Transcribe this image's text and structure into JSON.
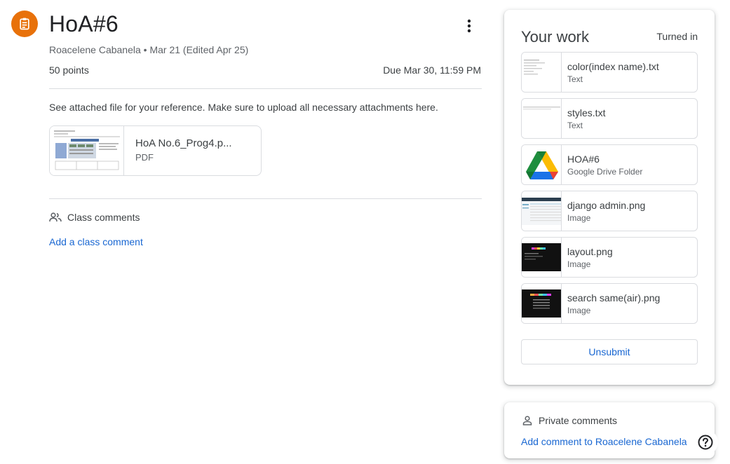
{
  "assignment": {
    "icon": "assignment-icon",
    "title": "HoA#6",
    "meta": "Roacelene Cabanela • Mar 21 (Edited Apr 25)",
    "points": "50 points",
    "due": "Due Mar 30, 11:59 PM",
    "instructions": "See attached file for your reference. Make sure to upload all necessary attachments here.",
    "attachment": {
      "name": "HoA No.6_Prog4.p...",
      "type": "PDF"
    },
    "accent_color": "#e8710a"
  },
  "class_comments": {
    "icon": "people-icon",
    "label": "Class comments",
    "add_label": "Add a class comment"
  },
  "your_work": {
    "title": "Your work",
    "status": "Turned in",
    "files": [
      {
        "name": "color(index name).txt",
        "type": "Text",
        "thumb": "text-doc"
      },
      {
        "name": "styles.txt",
        "type": "Text",
        "thumb": "text-doc"
      },
      {
        "name": "HOA#6",
        "type": "Google Drive Folder",
        "thumb": "drive-icon"
      },
      {
        "name": "django admin.png",
        "type": "Image",
        "thumb": "admin-screenshot"
      },
      {
        "name": "layout.png",
        "type": "Image",
        "thumb": "dark-screenshot"
      },
      {
        "name": "search same(air).png",
        "type": "Image",
        "thumb": "dark-screenshot"
      }
    ],
    "unsubmit_label": "Unsubmit"
  },
  "private_comments": {
    "icon": "person-icon",
    "label": "Private comments",
    "add_label": "Add comment to Roacelene Cabanela"
  },
  "help": {
    "icon": "help-icon"
  },
  "colors": {
    "link": "#1967d2",
    "border": "#dadce0",
    "text": "#3c4043"
  }
}
